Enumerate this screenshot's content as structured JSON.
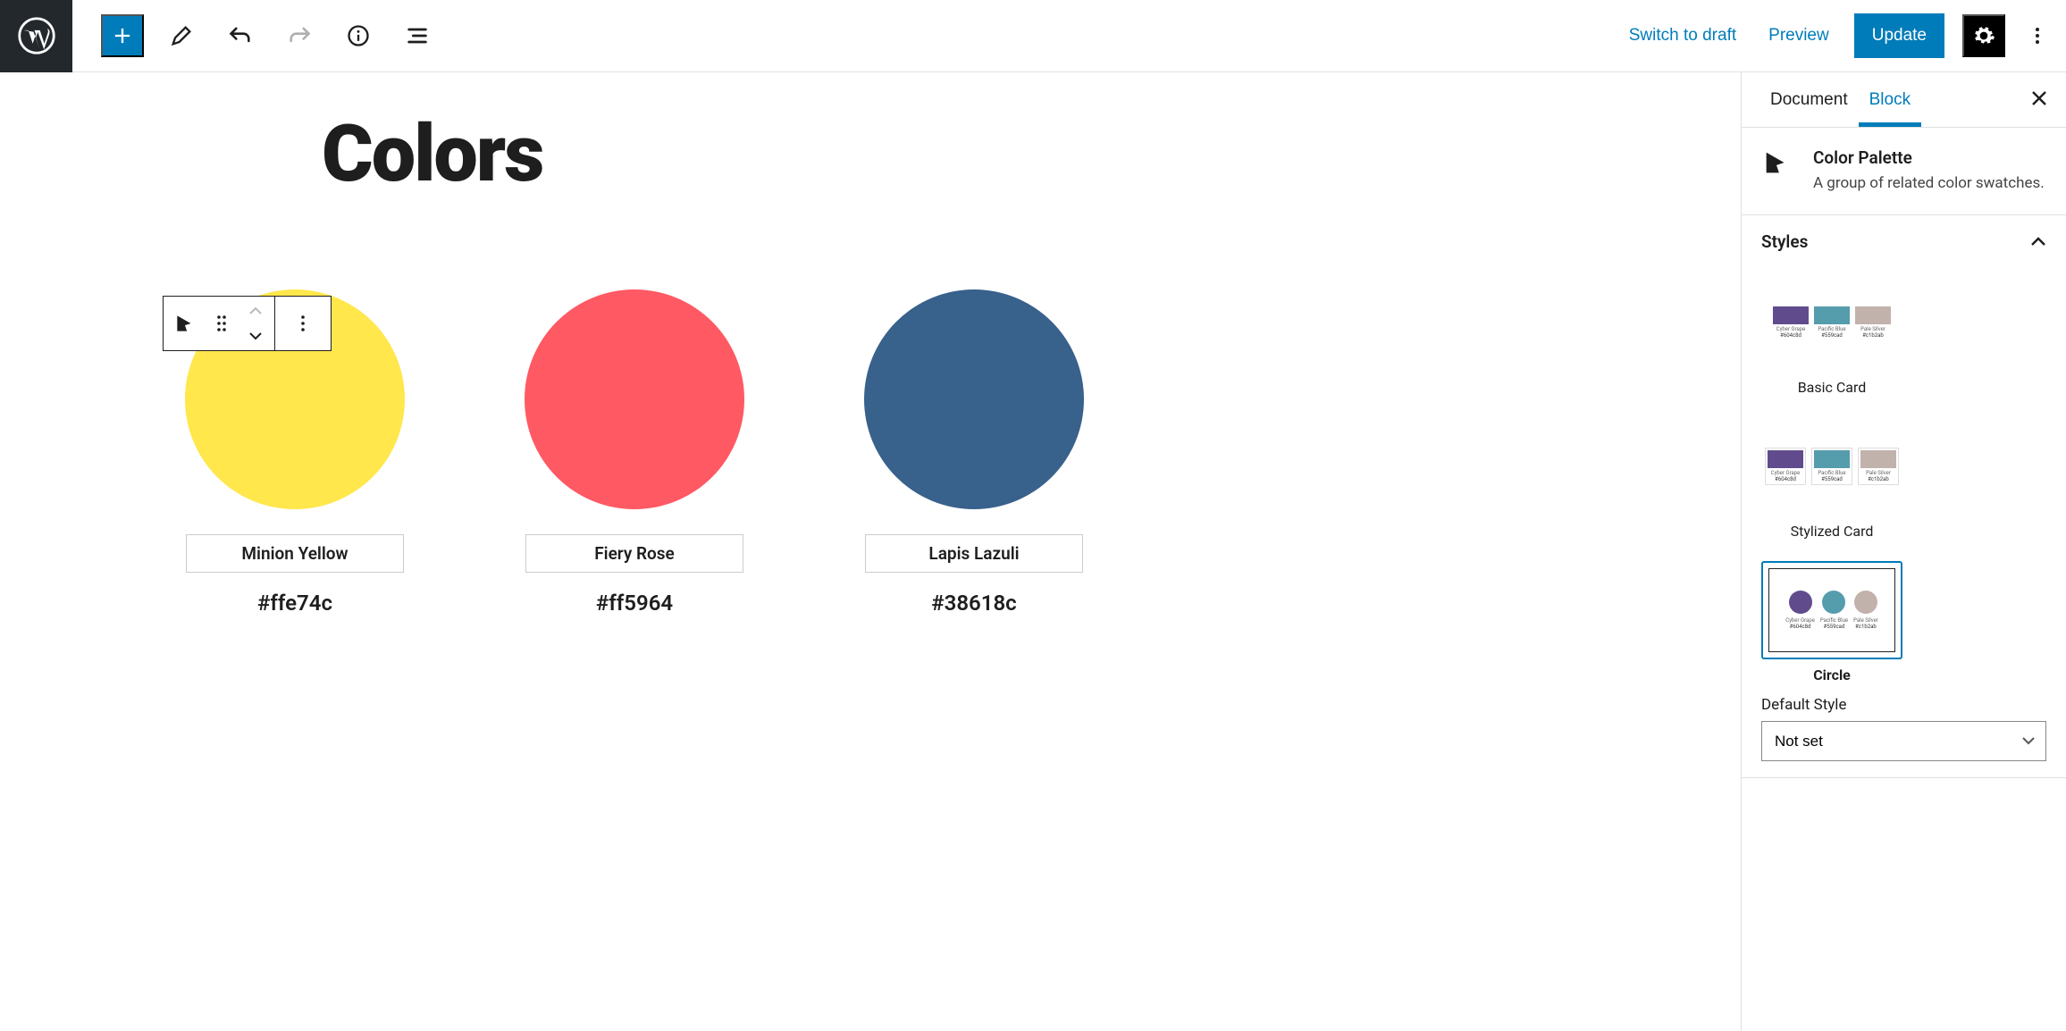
{
  "toolbar": {
    "switch_draft": "Switch to draft",
    "preview": "Preview",
    "update": "Update"
  },
  "editor": {
    "title": "Colors",
    "swatches": [
      {
        "name": "Minion Yellow",
        "hex": "#ffe74c"
      },
      {
        "name": "Fiery Rose",
        "hex": "#ff5964"
      },
      {
        "name": "Lapis Lazuli",
        "hex": "#38618c"
      }
    ]
  },
  "sidebar": {
    "tabs": {
      "document": "Document",
      "block": "Block"
    },
    "block_info": {
      "title": "Color Palette",
      "desc": "A group of related color swatches."
    },
    "styles": {
      "heading": "Styles",
      "options": [
        "Basic Card",
        "Stylized Card",
        "Circle"
      ],
      "selected": "Circle",
      "preview_colors": [
        {
          "name": "Cyber Grape",
          "hex": "#604c8d",
          "color": "#604c8d"
        },
        {
          "name": "Pacific Blue",
          "hex": "#559cad",
          "color": "#559cad"
        },
        {
          "name": "Pale Silver",
          "hex": "#c1b2ab",
          "color": "#c1b2ab"
        }
      ],
      "default_label": "Default Style",
      "default_value": "Not set"
    }
  }
}
